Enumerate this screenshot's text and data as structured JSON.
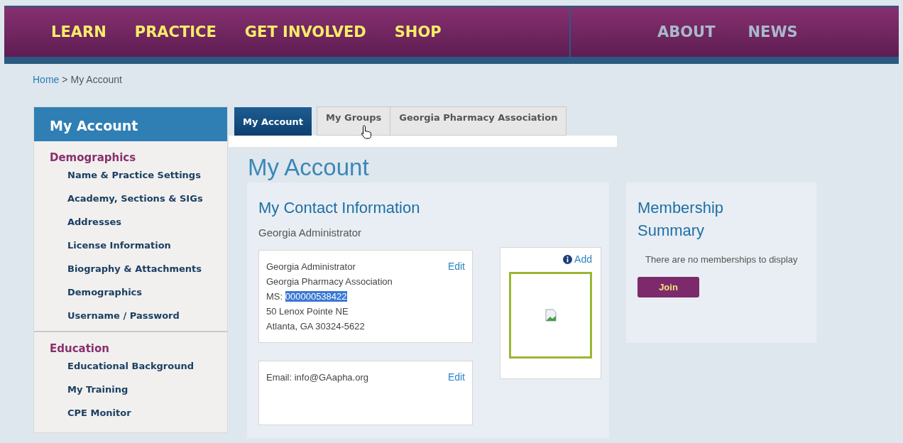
{
  "nav": {
    "primary": [
      "LEARN",
      "PRACTICE",
      "GET INVOLVED",
      "SHOP"
    ],
    "secondary": [
      "ABOUT",
      "NEWS"
    ]
  },
  "breadcrumb": {
    "home": "Home",
    "separator": ">",
    "current": "My Account"
  },
  "sidebar": {
    "title": "My Account",
    "sections": [
      {
        "heading": "Demographics",
        "items": [
          "Name & Practice Settings",
          "Academy, Sections & SIGs",
          "Addresses",
          "License Information",
          "Biography & Attachments",
          "Demographics",
          "Username / Password"
        ]
      },
      {
        "heading": "Education",
        "items": [
          "Educational Background",
          "My Training",
          "CPE Monitor"
        ]
      }
    ]
  },
  "tabs": [
    {
      "label": "My Account",
      "selected": true
    },
    {
      "label": "My Groups",
      "selected": false
    },
    {
      "label": "Georgia Pharmacy Association",
      "selected": false
    }
  ],
  "page_title": "My Account",
  "contact": {
    "title": "My Contact Information",
    "name": "Georgia Administrator",
    "address_lines": [
      "Georgia Administrator",
      "Georgia Pharmacy Association"
    ],
    "ms_label": "MS:",
    "ms_value": "000000538422",
    "ms_selected": true,
    "street_lines": [
      "50 Lenox Pointe NE",
      "Atlanta, GA 30324-5622"
    ],
    "edit": "Edit",
    "email": "Email: info@GAapha.org",
    "email_edit": "Edit",
    "photo_add": "Add"
  },
  "membership": {
    "title": "Membership Summary",
    "message": "There are no memberships to display",
    "button": "Join"
  }
}
